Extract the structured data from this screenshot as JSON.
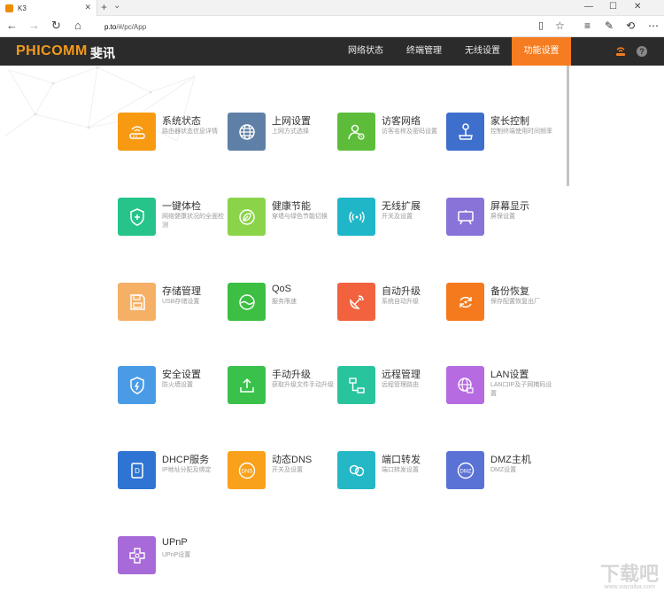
{
  "browser": {
    "tab_title": "K3",
    "tab_close": "✕",
    "new_tab": "+",
    "tab_more": "⌄",
    "window_controls": [
      "—",
      "☐",
      "✕"
    ],
    "url_host": "p.to",
    "url_path": "/#/pc/App"
  },
  "app": {
    "logo": "PHICOMM",
    "logo_cn": "斐讯",
    "menu": [
      "网络状态",
      "终端管理",
      "无线设置",
      "功能设置"
    ],
    "active_menu": "功能设置",
    "help_label": "?"
  },
  "tiles": [
    {
      "title": "系统状态",
      "desc": "路由器状态信息详情",
      "color": "#f79a12",
      "icon": "router-icon"
    },
    {
      "title": "上网设置",
      "desc": "上网方式选择",
      "color": "#5f80a6",
      "icon": "globe-icon"
    },
    {
      "title": "访客网络",
      "desc": "访客名称及密码设置",
      "color": "#5dbd3a",
      "icon": "guest-user-icon"
    },
    {
      "title": "家长控制",
      "desc": "控制终端使用时间频率",
      "color": "#3e6fcd",
      "icon": "joystick-icon"
    },
    {
      "title": "一键体检",
      "desc": "网络健康状况的全面检测",
      "color": "#26c48a",
      "icon": "shield-plus-icon"
    },
    {
      "title": "健康节能",
      "desc": "穿墙与绿色节能切换",
      "color": "#8bd44a",
      "icon": "leaf-icon"
    },
    {
      "title": "无线扩展",
      "desc": "开关及设置",
      "color": "#1fb6c8",
      "icon": "wireless-icon"
    },
    {
      "title": "屏幕显示",
      "desc": "屏保设置",
      "color": "#8a73d8",
      "icon": "screen-icon"
    },
    {
      "title": "存储管理",
      "desc": "USB存储设置",
      "color": "#f5b066",
      "icon": "floppy-icon"
    },
    {
      "title": "QoS",
      "desc": "服务限速",
      "color": "#3cbf43",
      "icon": "speed-icon"
    },
    {
      "title": "自动升级",
      "desc": "系统自动升级",
      "color": "#f2623f",
      "icon": "satellite-icon"
    },
    {
      "title": "备份恢复",
      "desc": "保存配置恢复出厂",
      "color": "#f57a1d",
      "icon": "restore-icon"
    },
    {
      "title": "安全设置",
      "desc": "防火墙设置",
      "color": "#4a9be6",
      "icon": "firewall-icon"
    },
    {
      "title": "手动升级",
      "desc": "获取升级文件手动升级",
      "color": "#39c14b",
      "icon": "upload-icon"
    },
    {
      "title": "远程管理",
      "desc": "远程管理路由",
      "color": "#28c49e",
      "icon": "remote-network-icon"
    },
    {
      "title": "LAN设置",
      "desc": "LAN口IP及子网掩码设置",
      "color": "#b76be0",
      "icon": "lan-globe-icon"
    },
    {
      "title": "DHCP服务",
      "desc": "IP地址分配及绑定",
      "color": "#2f74d2",
      "icon": "dhcp-icon"
    },
    {
      "title": "动态DNS",
      "desc": "开关及设置",
      "color": "#f9a11b",
      "icon": "dns-icon"
    },
    {
      "title": "端口转发",
      "desc": "端口转发设置",
      "color": "#24b8c6",
      "icon": "port-forward-icon"
    },
    {
      "title": "DMZ主机",
      "desc": "DMZ设置",
      "color": "#5a72d6",
      "icon": "dmz-icon"
    },
    {
      "title": "UPnP",
      "desc": "UPnP设置",
      "color": "#a76ad8",
      "icon": "upnp-icon"
    }
  ],
  "icon_labels": {
    "dns": "DNS",
    "dmz": "DMZ",
    "dhcp": "D"
  },
  "watermark": "下载吧",
  "watermark_url": "www.xiazaiba.com"
}
